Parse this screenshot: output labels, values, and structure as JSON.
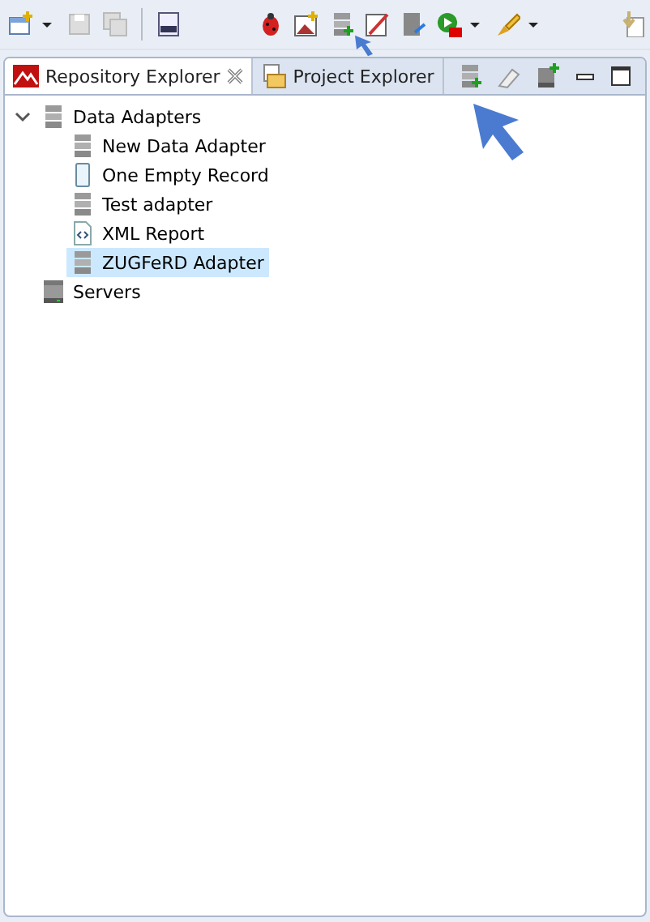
{
  "tabs": [
    {
      "label": "Repository Explorer",
      "selected": true,
      "kind": "repository"
    },
    {
      "label": "Project Explorer",
      "selected": false,
      "kind": "project"
    }
  ],
  "tree": [
    {
      "label": "Data Adapters",
      "kind": "folder",
      "expanded": true,
      "selected": false,
      "children": [
        {
          "label": "New Data Adapter",
          "kind": "adapter",
          "selected": false
        },
        {
          "label": "One Empty Record",
          "kind": "empty",
          "selected": false
        },
        {
          "label": "Test adapter",
          "kind": "adapter",
          "selected": false
        },
        {
          "label": "XML Report",
          "kind": "xml",
          "selected": false
        },
        {
          "label": "ZUGFeRD Adapter",
          "kind": "adapter",
          "selected": true
        }
      ]
    },
    {
      "label": "Servers",
      "kind": "server",
      "selected": false
    }
  ]
}
